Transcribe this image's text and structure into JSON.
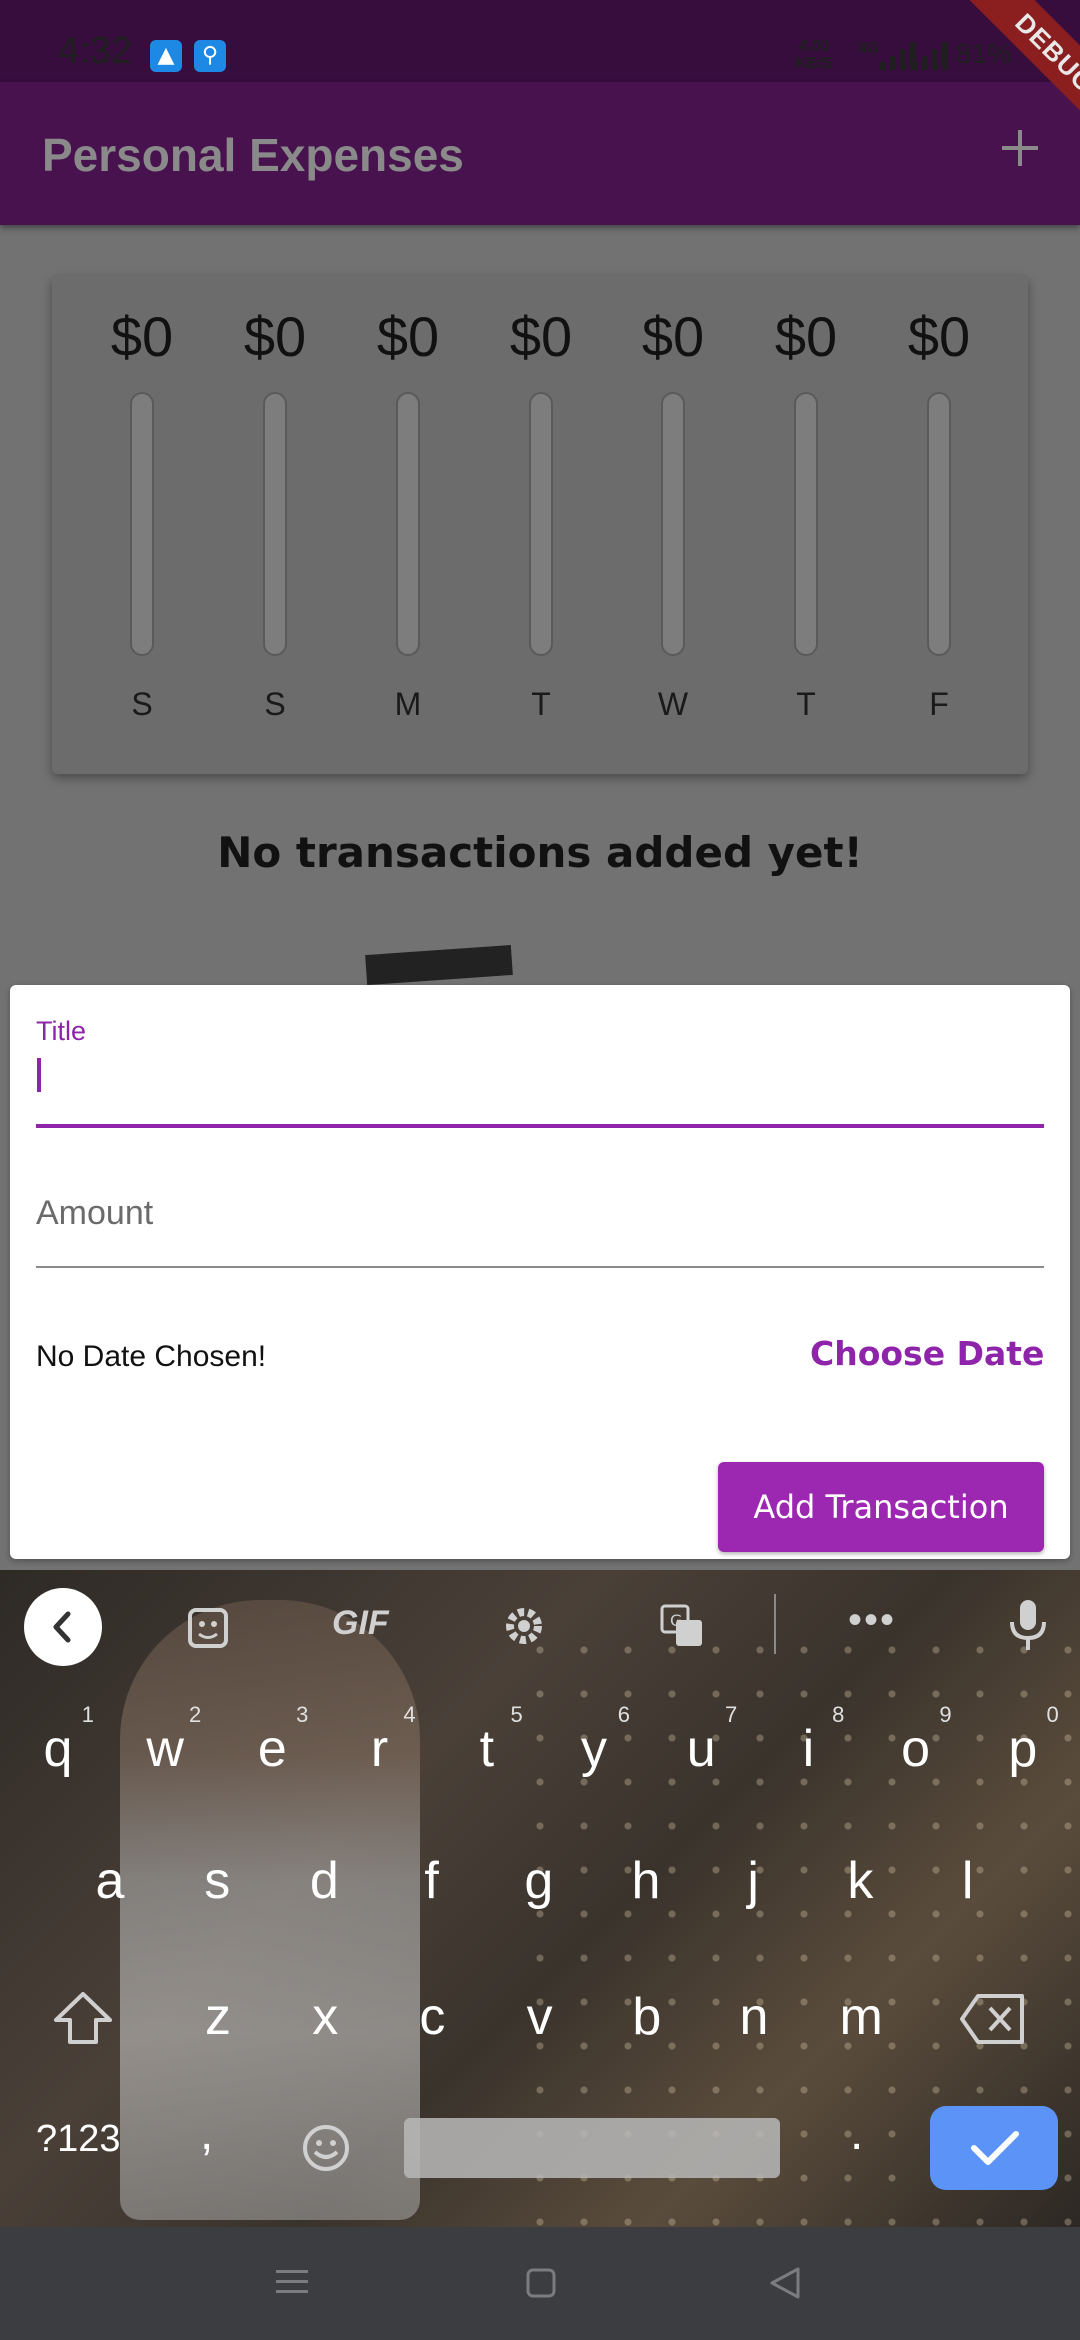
{
  "status_bar": {
    "time": "4:32",
    "speed_value": "4.00",
    "speed_unit": "KB/S",
    "network": "4G",
    "battery": "81%",
    "app_icons": [
      "android-icon",
      "usb-icon"
    ]
  },
  "debug_banner": "DEBUG",
  "app_bar": {
    "title": "Personal Expenses",
    "add_icon": "plus-icon"
  },
  "chart_data": {
    "type": "bar",
    "categories": [
      "S",
      "S",
      "M",
      "T",
      "W",
      "T",
      "F"
    ],
    "values": [
      0,
      0,
      0,
      0,
      0,
      0,
      0
    ],
    "labels": [
      "$0",
      "$0",
      "$0",
      "$0",
      "$0",
      "$0",
      "$0"
    ]
  },
  "empty_state": {
    "text": "No transactions added yet!"
  },
  "form": {
    "title_label": "Title",
    "title_value": "",
    "amount_placeholder": "Amount",
    "date_text": "No Date Chosen!",
    "choose_date_label": "Choose Date",
    "submit_label": "Add Transaction"
  },
  "keyboard": {
    "toolbar": [
      "back-icon",
      "sticker-icon",
      "GIF",
      "gear-icon",
      "translate-icon",
      "more-icon",
      "mic-icon"
    ],
    "gif_label": "GIF",
    "row1": [
      {
        "k": "q",
        "h": "1"
      },
      {
        "k": "w",
        "h": "2"
      },
      {
        "k": "e",
        "h": "3"
      },
      {
        "k": "r",
        "h": "4"
      },
      {
        "k": "t",
        "h": "5"
      },
      {
        "k": "y",
        "h": "6"
      },
      {
        "k": "u",
        "h": "7"
      },
      {
        "k": "i",
        "h": "8"
      },
      {
        "k": "o",
        "h": "9"
      },
      {
        "k": "p",
        "h": "0"
      }
    ],
    "row2": [
      "a",
      "s",
      "d",
      "f",
      "g",
      "h",
      "j",
      "k",
      "l"
    ],
    "row3": [
      "z",
      "x",
      "c",
      "v",
      "b",
      "n",
      "m"
    ],
    "symbols_label": "?123",
    "comma": ",",
    "period": "."
  },
  "nav_bar": {
    "icons": [
      "menu-icon",
      "home-icon",
      "back-icon"
    ]
  }
}
